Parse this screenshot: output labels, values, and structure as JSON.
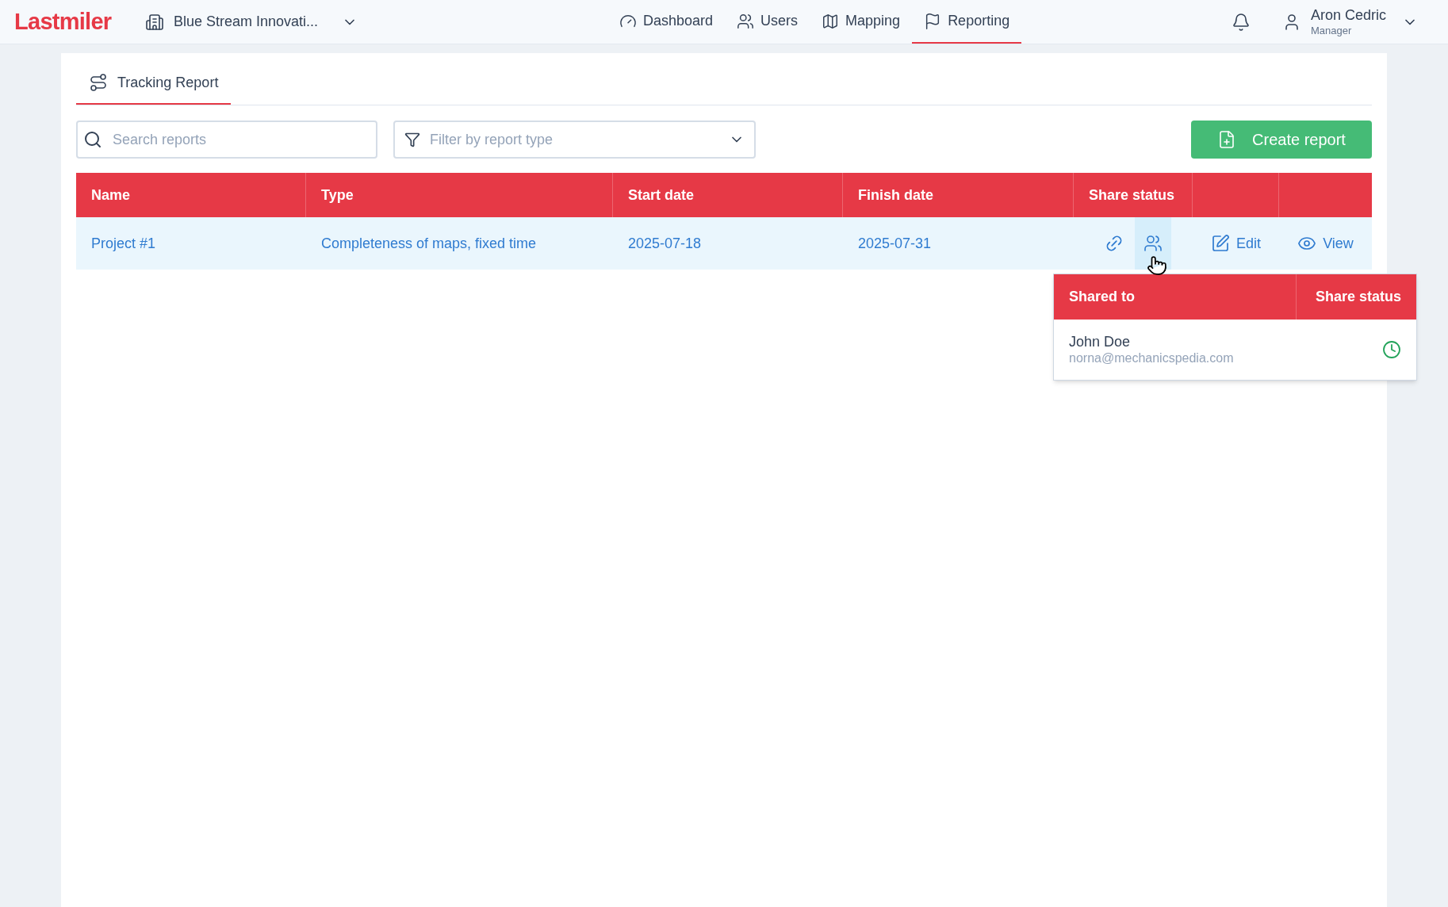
{
  "header": {
    "logo": "Lastmiler",
    "organization": "Blue Stream Innovati...",
    "nav": [
      {
        "label": "Dashboard",
        "kind": "dashboard",
        "selected": false
      },
      {
        "label": "Users",
        "kind": "users",
        "selected": false
      },
      {
        "label": "Mapping",
        "kind": "mapping",
        "selected": false
      },
      {
        "label": "Reporting",
        "kind": "reporting",
        "selected": true
      }
    ],
    "user": {
      "name": "Aron Cedric",
      "role": "Manager"
    }
  },
  "tabs": [
    {
      "label": "Tracking Report",
      "selected": true
    }
  ],
  "search": {
    "placeholder": "Search reports"
  },
  "filter": {
    "placeholder": "Filter by report type"
  },
  "create_button": "Create report",
  "table": {
    "columns": [
      "Name",
      "Type",
      "Start date",
      "Finish date",
      "Share status"
    ],
    "rows": [
      {
        "name": "Project #1",
        "type": "Completeness of maps, fixed time",
        "start": "2025-07-18",
        "finish": "2025-07-31",
        "link_selected": false,
        "users_selected": true,
        "edit": "Edit",
        "view": "View"
      }
    ]
  },
  "share_popup": {
    "columns": [
      "Shared to",
      "Share status"
    ],
    "entries": [
      {
        "name": "John Doe",
        "email": "norna@mechanicspedia.com",
        "kind": "pending"
      }
    ]
  }
}
